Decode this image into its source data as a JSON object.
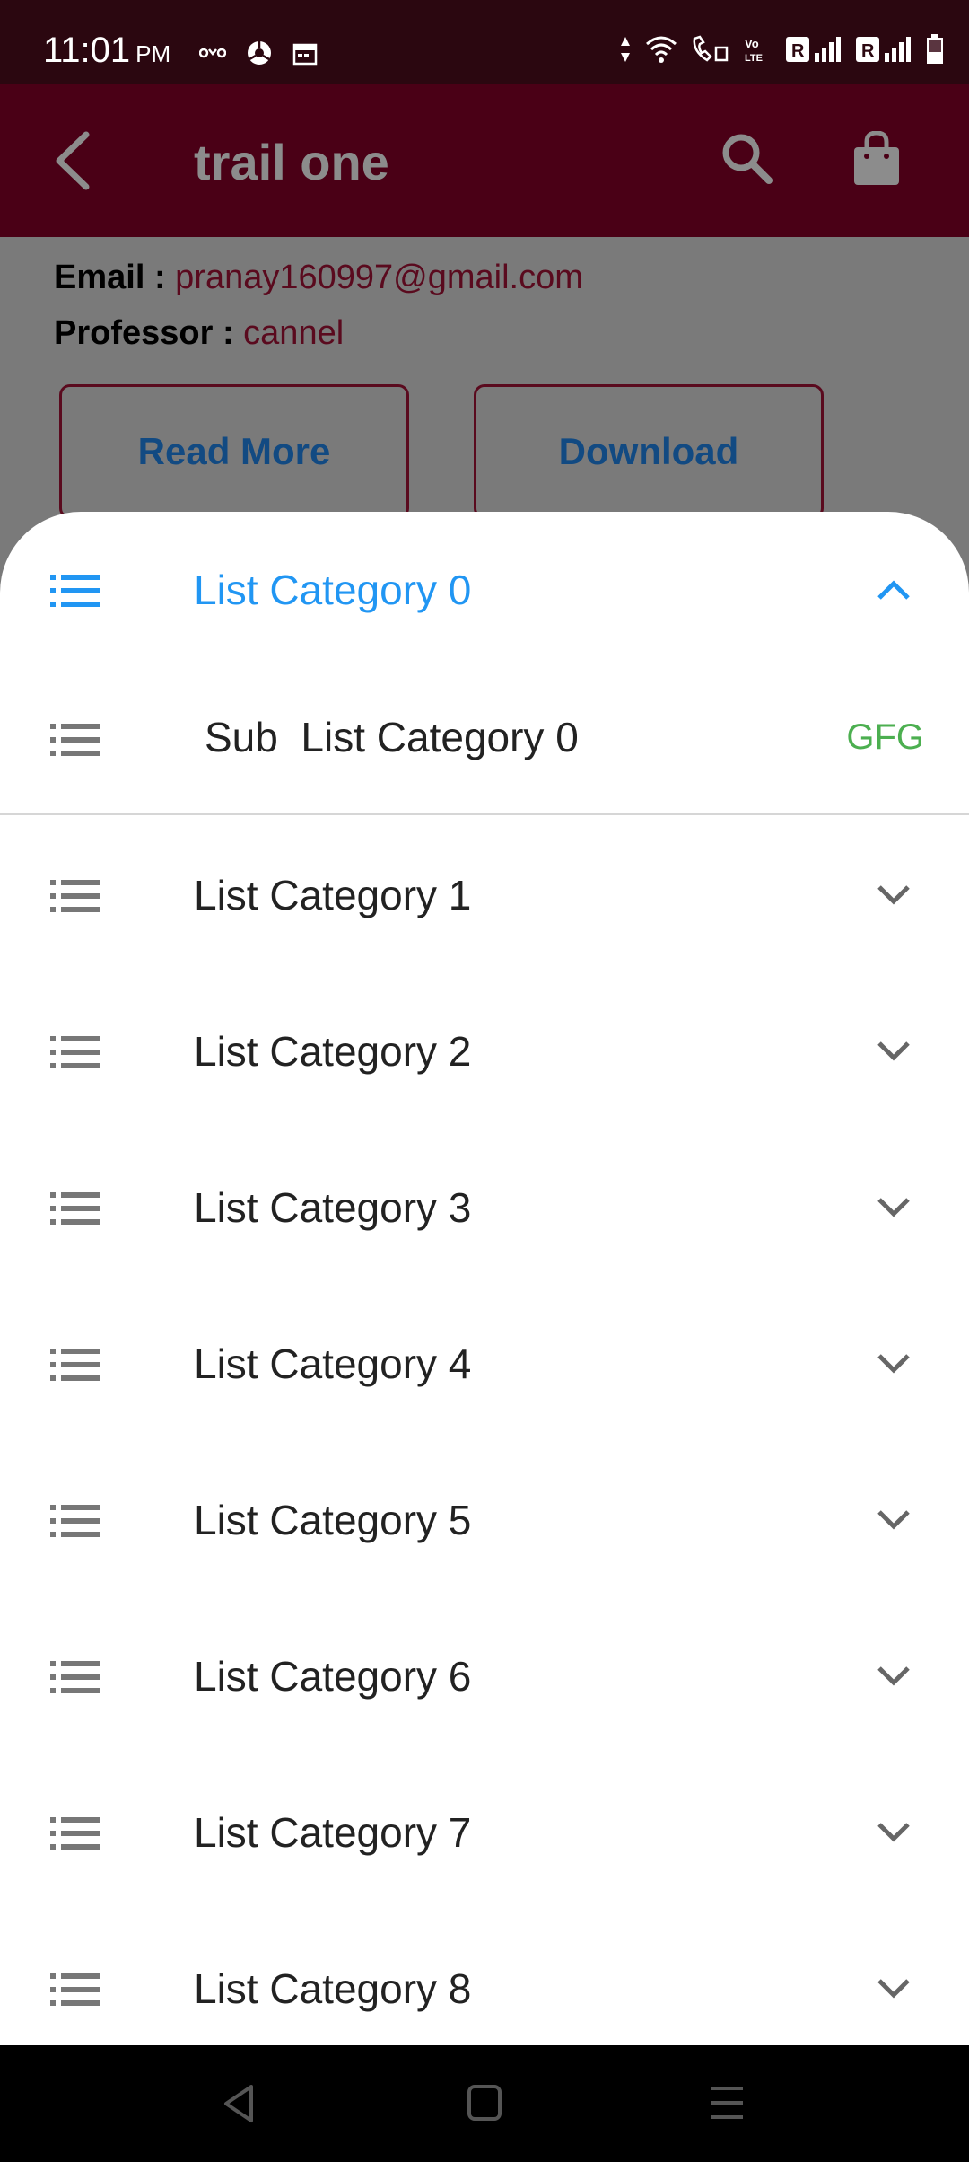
{
  "status_bar": {
    "time": "11:01",
    "ampm": "PM",
    "left_icons": [
      "oyo-icon",
      "chrome-icon",
      "calendar-icon"
    ],
    "right_icons": [
      "data-arrows-icon",
      "wifi-icon",
      "wifi-call-icon",
      "volte-icon",
      "sim1-signal-icon",
      "sim2-signal-icon",
      "battery-icon"
    ]
  },
  "app_bar": {
    "title": "trail one",
    "back_icon": "back-arrow-icon",
    "search_icon": "search-icon",
    "bag_icon": "shopping-bag-icon"
  },
  "background": {
    "email_key": "Email : ",
    "email_value": "pranay160997@gmail.com",
    "professor_key": "Professor : ",
    "professor_value": "cannel",
    "read_more_label": "Read More",
    "download_label": "Download"
  },
  "sheet": {
    "categories": [
      {
        "label": "List Category 0",
        "expanded": true
      },
      {
        "label": "List Category 1",
        "expanded": false
      },
      {
        "label": "List Category 2",
        "expanded": false
      },
      {
        "label": "List Category 3",
        "expanded": false
      },
      {
        "label": "List Category 4",
        "expanded": false
      },
      {
        "label": "List Category 5",
        "expanded": false
      },
      {
        "label": "List Category 6",
        "expanded": false
      },
      {
        "label": "List Category 7",
        "expanded": false
      },
      {
        "label": "List Category 8",
        "expanded": false
      }
    ],
    "sub_item": {
      "label": "Sub  List Category 0",
      "trailing": "GFG"
    }
  },
  "colors": {
    "status_bar": "#2b0710",
    "app_bar": "#4a0016",
    "accent_blue": "#2196f3",
    "gfg_green": "#4caf50"
  }
}
